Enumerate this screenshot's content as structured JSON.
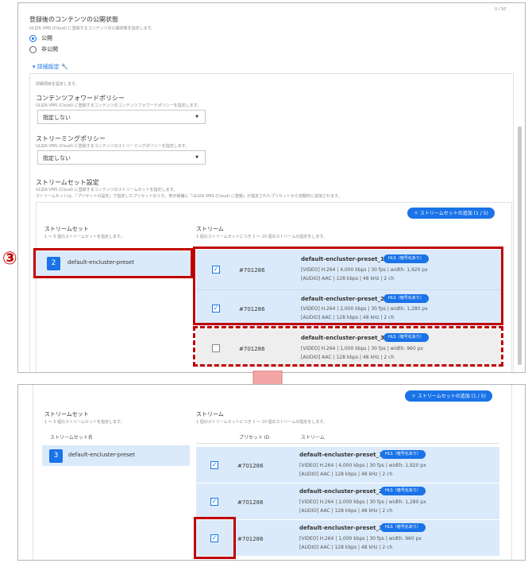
{
  "top": {
    "counter": "0 / 50",
    "publish": {
      "title": "登録後のコンテンツの公開状態",
      "desc": "ULIZA VMS (Cloud) に登録するコンテンツの公開状態を指定します。",
      "options": [
        "公開",
        "非公開"
      ],
      "selected": "公開"
    },
    "details_toggle": "▾ 詳細設定",
    "details_desc": "詳細項目を設定します。",
    "forward_policy": {
      "title": "コンテンツフォワードポリシー",
      "desc": "ULIZA VMS (Cloud) に登録するコンテンツのコンテンツフォワードポリシーを指定します。",
      "value": "指定しない"
    },
    "streaming_policy": {
      "title": "ストリーミングポリシー",
      "desc": "ULIZA VMS (Cloud) に登録するコンテンツのストリーミングポリシーを指定します。",
      "value": "指定しない"
    },
    "stream_set_settings": {
      "title": "ストリームセット設定",
      "desc1": "ULIZA VMS (Cloud) に登録するコンテンツのストリームセットを指定します。",
      "desc2": "ストリームセットは、「プリセットの設定」で指定したプリセットのうち、表示候補に「ULIZA VMS (Cloud) に登録」が指定されたプリセットから自動的に追加されます。"
    },
    "add_button": "＋ ストリームセットの追加 (1 / 5)",
    "streamset_header": "ストリームセット",
    "streamset_desc": "1 ～ 5 個のストリームセットを指定します。",
    "stream_header": "ストリーム",
    "stream_desc": "1 個のストリームセットにつき 1 ～ 10 個のストリームの指定をします。",
    "step_marker": "③",
    "preset": {
      "num": "2",
      "name": "default-encluster-preset"
    },
    "rows": [
      {
        "checked": true,
        "id": "#701286",
        "name": "default-encluster-preset_1",
        "badge": "HLS（暗号化あり）",
        "video": "[VIDEO] H.264 | 4,000 kbps | 30 fps | width: 1,920 px",
        "audio": "[AUDIO] AAC | 128 kbps | 48 kHz | 2 ch"
      },
      {
        "checked": true,
        "id": "#701286",
        "name": "default-encluster-preset_2",
        "badge": "HLS（暗号化あり）",
        "video": "[VIDEO] H.264 | 2,000 kbps | 30 fps | width: 1,280 px",
        "audio": "[AUDIO] AAC | 128 kbps | 48 kHz | 2 ch"
      },
      {
        "checked": false,
        "id": "#701286",
        "name": "default-encluster-preset_3",
        "badge": "HLS（暗号化あり）",
        "video": "[VIDEO] H.264 | 1,000 kbps | 30 fps | width: 960 px",
        "audio": "[AUDIO] AAC | 128 kbps | 48 kHz | 2 ch"
      }
    ]
  },
  "bottom": {
    "add_button": "＋ ストリームセットの追加 (1 / 5)",
    "streamset_header": "ストリームセット",
    "streamset_desc": "1 ～ 5 個のストリームセットを指定します。",
    "stream_header": "ストリーム",
    "stream_desc": "1 個のストリームセットにつき 1 ～ 10 個のストリームの指定をします。",
    "col_streamset_name": "ストリームセット名",
    "col_preset_id": "プリセット ID",
    "col_stream": "ストリーム",
    "preset": {
      "num": "3",
      "name": "default-encluster-preset"
    },
    "rows": [
      {
        "checked": true,
        "id": "#701286",
        "name": "default-encluster-preset_1",
        "badge": "HLS（暗号化あり）",
        "video": "[VIDEO] H.264 | 4,000 kbps | 30 fps | width: 1,920 px",
        "audio": "[AUDIO] AAC | 128 kbps | 48 kHz | 2 ch"
      },
      {
        "checked": true,
        "id": "#701286",
        "name": "default-encluster-preset_2",
        "badge": "HLS（暗号化あり）",
        "video": "[VIDEO] H.264 | 2,000 kbps | 30 fps | width: 1,280 px",
        "audio": "[AUDIO] AAC | 128 kbps | 48 kHz | 2 ch"
      },
      {
        "checked": true,
        "id": "#701286",
        "name": "default-encluster-preset_3",
        "badge": "HLS（暗号化あり）",
        "video": "[VIDEO] H.264 | 1,000 kbps | 30 fps | width: 960 px",
        "audio": "[AUDIO] AAC | 128 kbps | 48 kHz | 2 ch"
      }
    ]
  },
  "colors": {
    "accent": "#1a73e8",
    "highlight": "#c00000",
    "row_bg": "#dbeafa",
    "arrow": "#f4a6a6"
  }
}
